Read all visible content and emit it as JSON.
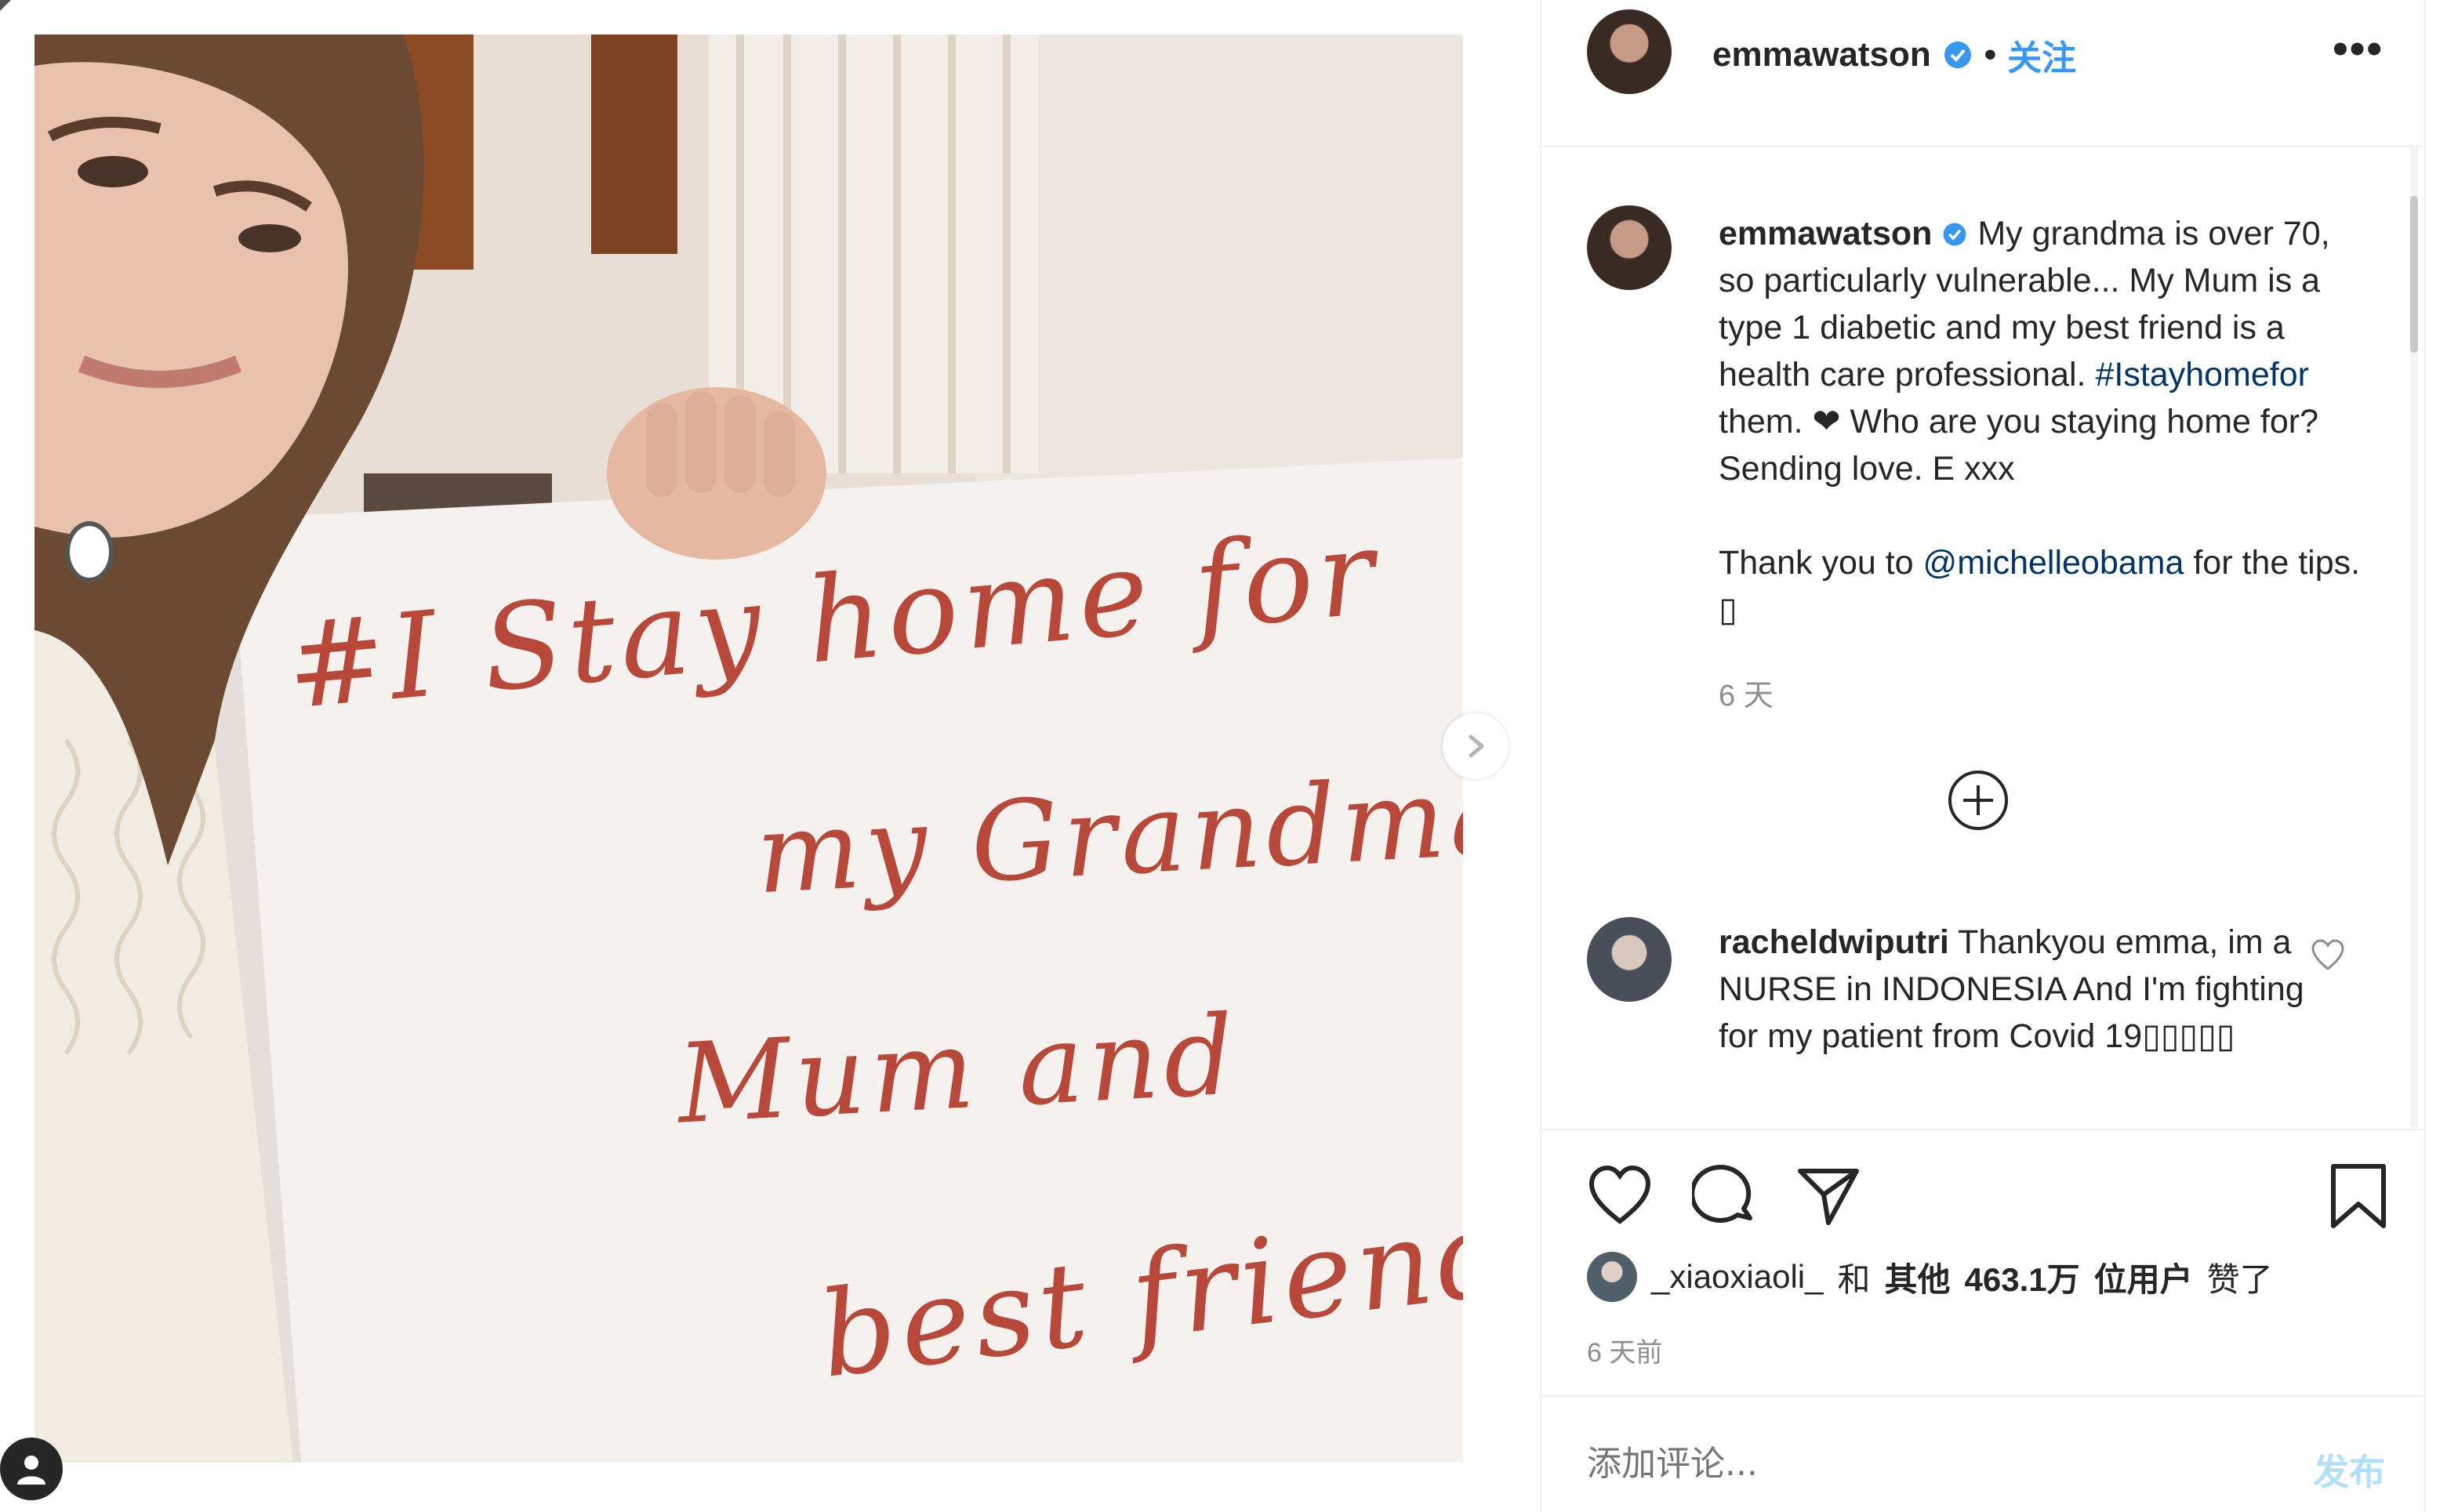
{
  "photo": {
    "sign_lines": [
      "#I  Stay home for",
      "my Grandma",
      "Mum and",
      "best friend"
    ],
    "ink_color": "#b8493a"
  },
  "header": {
    "username": "emmawatson",
    "separator": "•",
    "follow_label": "关注",
    "more_label": "•••"
  },
  "caption": {
    "username": "emmawatson",
    "text_a": "My grandma is over 70, so particularly vulnerable... My Mum is a type 1 diabetic and my best friend is a health care professional.",
    "hashtag": "#Istayhomefor",
    "text_b": "them. ❤ Who are you staying home for?  Sending love. E xxx",
    "thanks_a": "Thank you to",
    "mention": "@michelleobama",
    "thanks_b": "for the tips. ▯",
    "time": "6 天"
  },
  "comments": [
    {
      "username": "racheldwiputri",
      "text": "Thankyou emma, im a NURSE in INDONESIA And I'm fighting for my patient from Covid 19▯▯▯▯▯"
    }
  ],
  "likes": {
    "user": "_xiaoxiaoli_",
    "middle": "和",
    "others_label": "其他",
    "count": "463.1万",
    "suffix_bold": "位用户",
    "suffix": "赞了"
  },
  "post_time": "6 天前",
  "comment_box": {
    "placeholder": "添加评论...",
    "post_label": "发布"
  },
  "colors": {
    "link": "#003569",
    "accent": "#3897f0",
    "muted": "#8e8e8e"
  },
  "icons": [
    "verified-icon",
    "ellipsis-icon",
    "add-circle-icon",
    "heart-icon",
    "comment-icon",
    "share-icon",
    "bookmark-icon",
    "chevron-right-icon",
    "user-icon"
  ]
}
